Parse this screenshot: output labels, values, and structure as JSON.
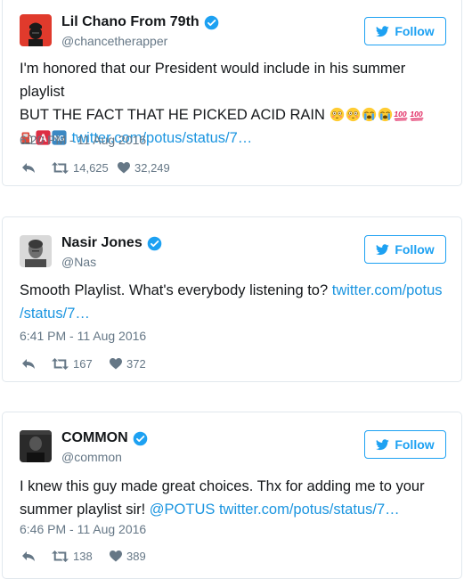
{
  "tweets": [
    {
      "display_name": "Lil Chano From 79th",
      "handle": "@chancetherapper",
      "follow_label": "Follow",
      "text_line1": "I'm honored that our President would include in his summer playlist",
      "text_line2": "BUT THE FACT THAT HE PICKED ACID RAIN",
      "text_link": "twitter.com/potus/status/7…",
      "emoji_row1": [
        "flushed-face",
        "flushed-face",
        "loudly-crying-face",
        "loudly-crying-face",
        "hundred-points"
      ],
      "emoji_row2": [
        "fuel-pump",
        "a-button",
        "ng-button"
      ],
      "timestamp": "6:20 PM - 11 Aug 2016",
      "retweets": "14,625",
      "likes": "32,249"
    },
    {
      "display_name": "Nasir Jones",
      "handle": "@Nas",
      "follow_label": "Follow",
      "text_plain": "Smooth Playlist. What's everybody listening to?",
      "text_link_a": "twitter.com/potus",
      "text_link_b": "/status/7…",
      "timestamp": "6:41 PM - 11 Aug 2016",
      "retweets": "167",
      "likes": "372"
    },
    {
      "display_name": "COMMON",
      "handle": "@common",
      "follow_label": "Follow",
      "text_line1": "I knew this guy made great choices. Thx for adding me to your",
      "text_line2_plain": "summer playlist sir!",
      "text_mention": "@POTUS",
      "text_link": "twitter.com/potus/status/7…",
      "timestamp": "6:46 PM - 11 Aug 2016",
      "retweets": "138",
      "likes": "389"
    }
  ],
  "colors": {
    "brand_blue": "#1da1f2",
    "link_blue": "#1b95e0",
    "meta_gray": "#657786",
    "border": "#e1e8ed"
  },
  "icons": [
    "verified-badge-icon",
    "twitter-bird-icon",
    "reply-icon",
    "retweet-icon",
    "heart-icon"
  ]
}
